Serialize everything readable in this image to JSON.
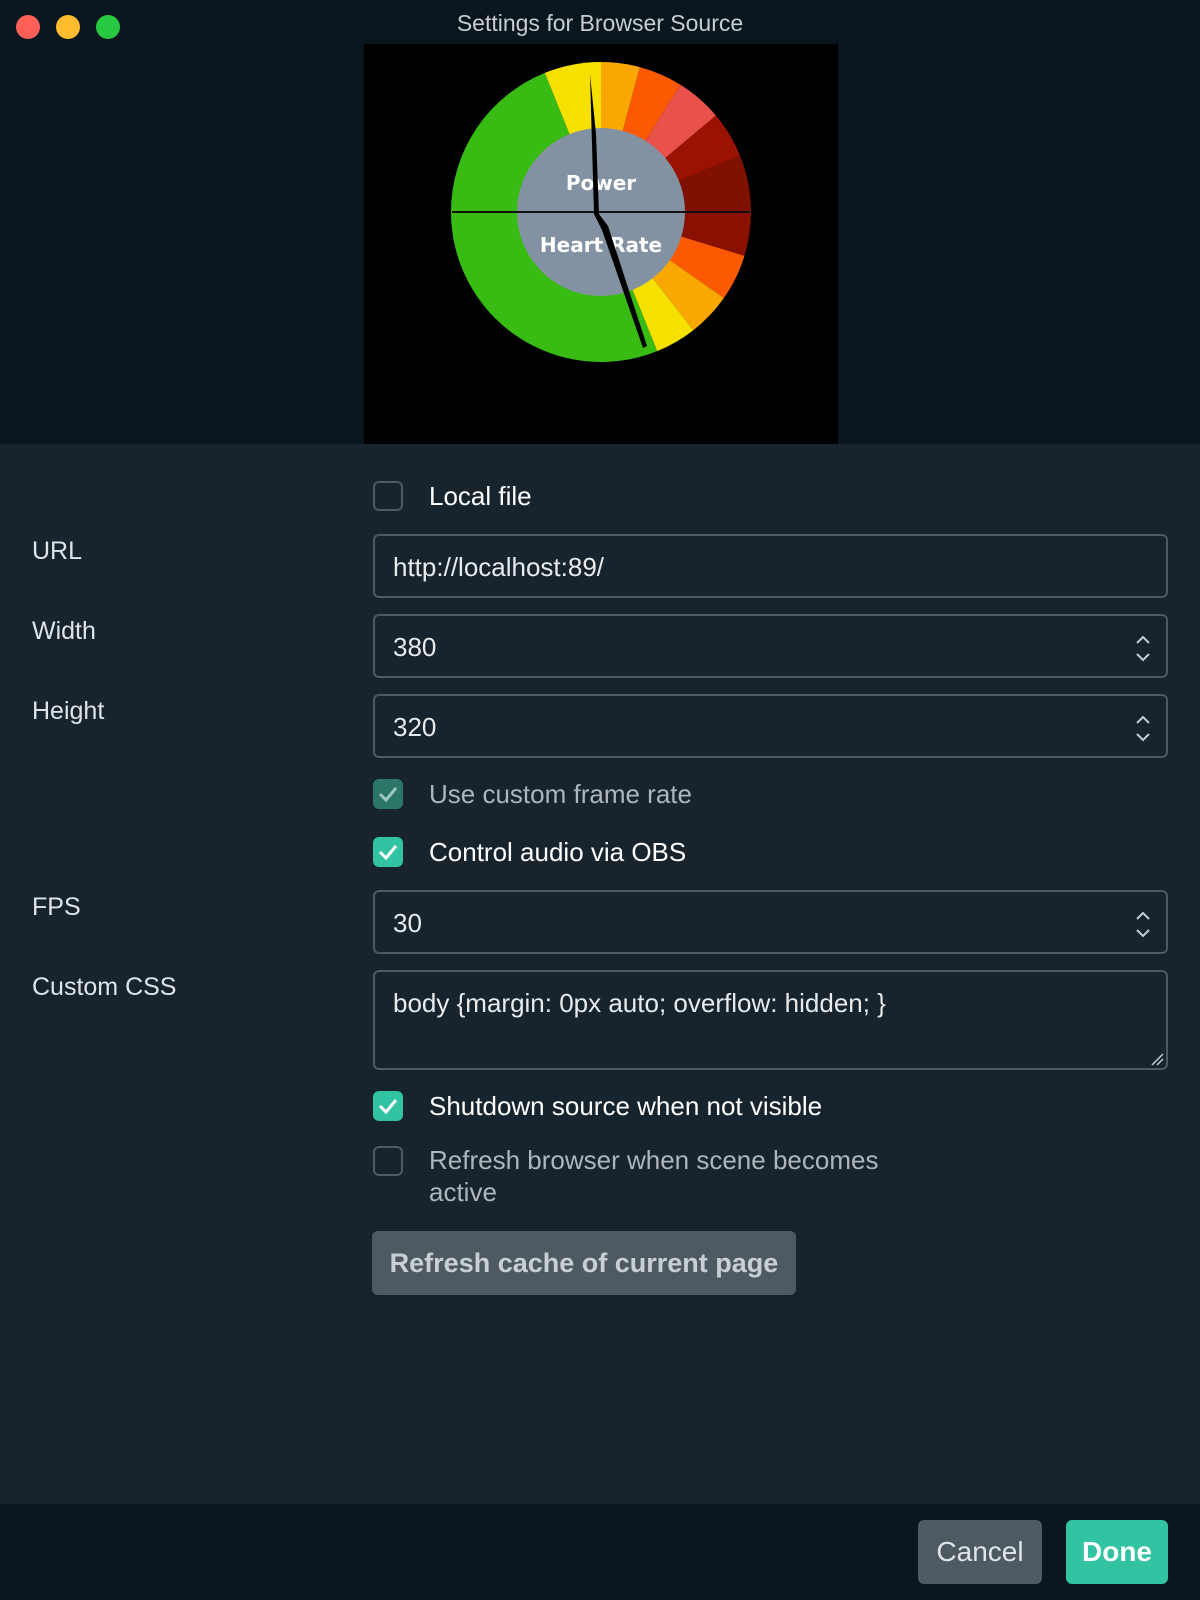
{
  "window": {
    "title": "Settings for Browser Source"
  },
  "preview": {
    "gauge": {
      "upper_label": "Power",
      "lower_label": "Heart Rate"
    }
  },
  "form": {
    "local_file": {
      "label": "Local file",
      "checked": false
    },
    "url": {
      "label": "URL",
      "value": "http://localhost:89/"
    },
    "width": {
      "label": "Width",
      "value": "380"
    },
    "height": {
      "label": "Height",
      "value": "320"
    },
    "custom_frame_rate": {
      "label": "Use custom frame rate",
      "checked": true,
      "disabled": true
    },
    "control_audio": {
      "label": "Control audio via OBS",
      "checked": true
    },
    "fps": {
      "label": "FPS",
      "value": "30"
    },
    "custom_css": {
      "label": "Custom CSS",
      "value": "body {margin: 0px auto; overflow: hidden; }"
    },
    "shutdown_source": {
      "label": "Shutdown source when not visible",
      "checked": true
    },
    "refresh_on_active": {
      "label_line1": "Refresh browser when scene becomes",
      "label_line2": "active",
      "checked": false
    },
    "refresh_cache_button": "Refresh cache of current page"
  },
  "footer": {
    "cancel": "Cancel",
    "done": "Done"
  },
  "colors": {
    "accent": "#31c3a2",
    "background": "#17242d",
    "titlebar": "#09161d"
  }
}
